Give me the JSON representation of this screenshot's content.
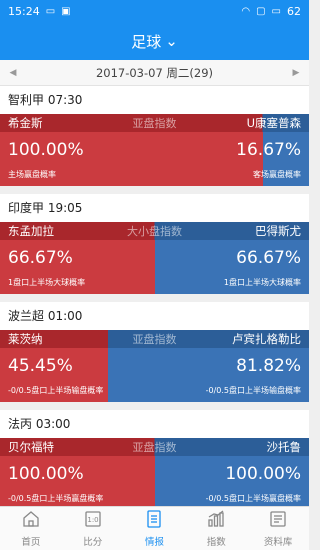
{
  "status": {
    "time": "15:24",
    "battery": "62"
  },
  "header": {
    "title": "足球"
  },
  "date_bar": {
    "date": "2017-03-07 周二(29)"
  },
  "colors": {
    "primary": "#1a8ff0",
    "red": "#cb3b40",
    "blue": "#3a73b6"
  },
  "matches": [
    {
      "league_time": "智利甲 07:30",
      "left_team": "希金斯",
      "right_team": "U康塞普森",
      "market": "亚盘指数",
      "left_pct": "100.00%",
      "right_pct": "16.67%",
      "left_label": "主场赢盘概率",
      "right_label": "客场赢盘概率",
      "left_share": 0.85
    },
    {
      "league_time": "印度甲 19:05",
      "left_team": "东孟加拉",
      "right_team": "巴得斯尤",
      "market": "大小盘指数",
      "left_pct": "66.67%",
      "right_pct": "66.67%",
      "left_label": "1盘口上半场大球概率",
      "right_label": "1盘口上半场大球概率",
      "left_share": 0.5
    },
    {
      "league_time": "波兰超 01:00",
      "left_team": "莱茨纳",
      "right_team": "卢宾扎格勒比",
      "market": "亚盘指数",
      "left_pct": "45.45%",
      "right_pct": "81.82%",
      "left_label": "-0/0.5盘口上半场输盘概率",
      "right_label": "-0/0.5盘口上半场输盘概率",
      "left_share": 0.35
    },
    {
      "league_time": "法丙 03:00",
      "left_team": "贝尔福特",
      "right_team": "沙托鲁",
      "market": "亚盘指数",
      "left_pct": "100.00%",
      "right_pct": "100.00%",
      "left_label": "-0/0.5盘口上半场赢盘概率",
      "right_label": "-0/0.5盘口上半场赢盘概率",
      "left_share": 0.5
    }
  ],
  "tabs": [
    {
      "label": "首页",
      "icon": "home-icon"
    },
    {
      "label": "比分",
      "icon": "score-icon"
    },
    {
      "label": "情报",
      "icon": "report-icon"
    },
    {
      "label": "指数",
      "icon": "chart-icon"
    },
    {
      "label": "资料库",
      "icon": "database-icon"
    }
  ],
  "active_tab": 2
}
